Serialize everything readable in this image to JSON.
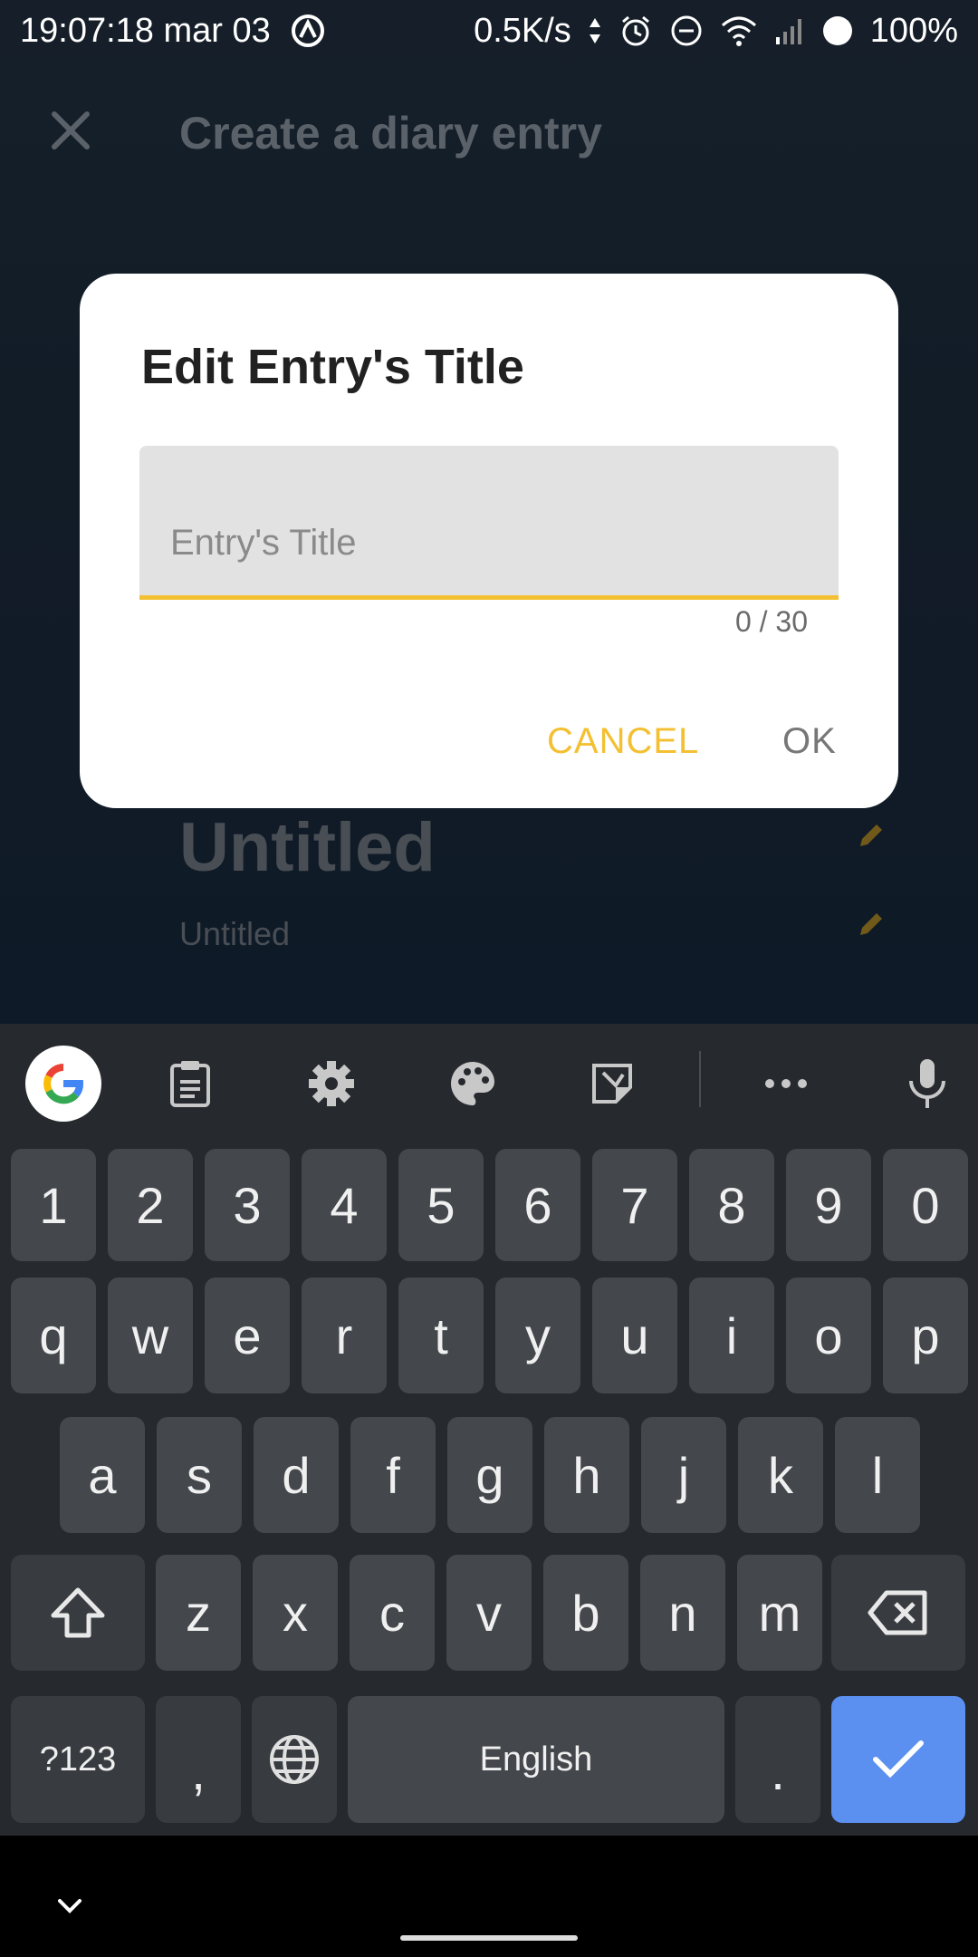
{
  "status_bar": {
    "time": "19:07:18 mar 03",
    "net_speed": "0.5K/s",
    "battery": "100%"
  },
  "app": {
    "title": "Create a diary entry",
    "entry_title": "Untitled",
    "entry_subtitle": "Untitled"
  },
  "dialog": {
    "title": "Edit Entry's Title",
    "field": {
      "value": "",
      "placeholder": "Entry's Title"
    },
    "counter": "0 / 30",
    "cancel_label": "CANCEL",
    "ok_label": "OK"
  },
  "keyboard": {
    "row_numbers": [
      "1",
      "2",
      "3",
      "4",
      "5",
      "6",
      "7",
      "8",
      "9",
      "0"
    ],
    "row1": [
      "q",
      "w",
      "e",
      "r",
      "t",
      "y",
      "u",
      "i",
      "o",
      "p"
    ],
    "row2": [
      "a",
      "s",
      "d",
      "f",
      "g",
      "h",
      "j",
      "k",
      "l"
    ],
    "row3": [
      "z",
      "x",
      "c",
      "v",
      "b",
      "n",
      "m"
    ],
    "symbols_label": "?123",
    "comma": ",",
    "period": ".",
    "space_label": "English"
  },
  "colors": {
    "accent": "#f4c033",
    "enter_key": "#5b8ff0",
    "keyboard_bg": "#262a2e",
    "key_bg": "#44484d"
  }
}
